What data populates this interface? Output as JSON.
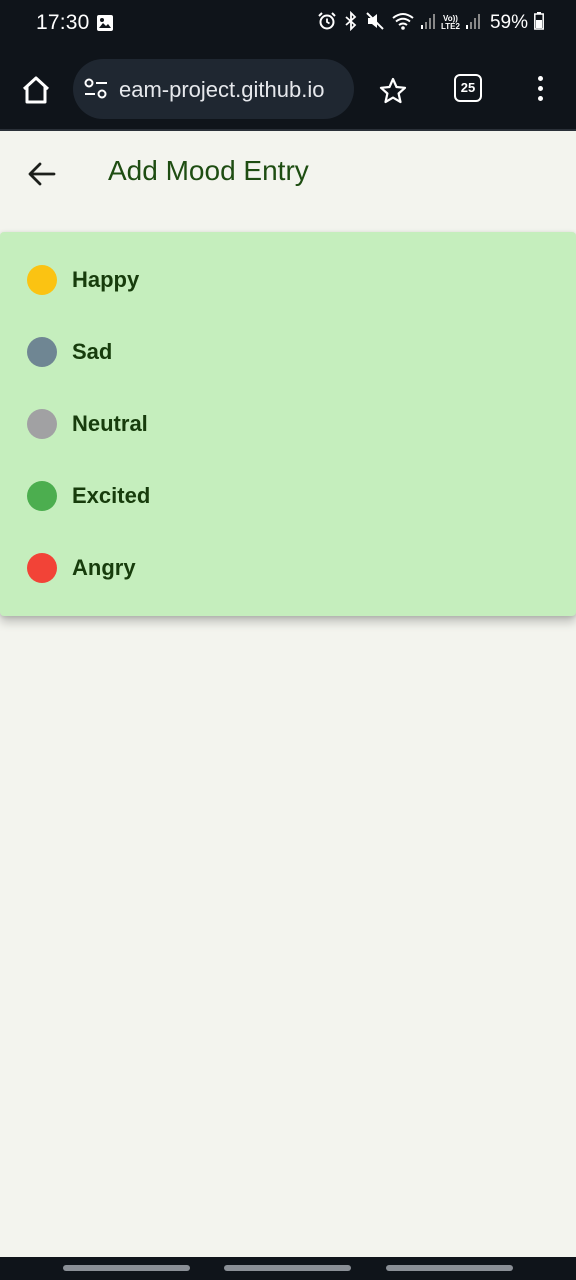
{
  "status_bar": {
    "time": "17:30",
    "battery": "59%",
    "network": "LTE2",
    "volte": "Vo))"
  },
  "browser": {
    "url": "eam-project.github.io",
    "tab_count": "25"
  },
  "app_bar": {
    "title": "Add Mood Entry"
  },
  "mood_menu": {
    "items": [
      {
        "label": "Happy",
        "color": "#fbc312"
      },
      {
        "label": "Sad",
        "color": "#6f8693"
      },
      {
        "label": "Neutral",
        "color": "#a1a1a3"
      },
      {
        "label": "Excited",
        "color": "#4cae4f"
      },
      {
        "label": "Angry",
        "color": "#f24337"
      }
    ]
  }
}
